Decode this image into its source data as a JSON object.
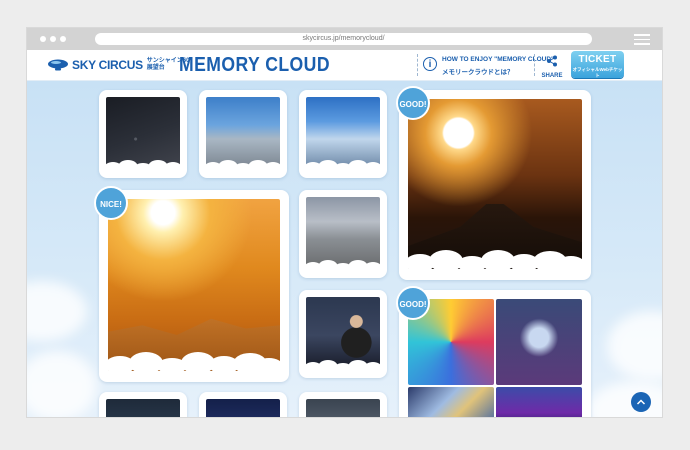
{
  "browser": {
    "url": "skycircus.jp/memorycloud/"
  },
  "header": {
    "logo_text": "SKY CIRCUS",
    "logo_sub_line1": "サンシャイン60",
    "logo_sub_line2": "展望台",
    "logo_sub_num": "60",
    "site_title": "MEMORY CLOUD",
    "how_line1": "HOW TO ENJOY \"MEMORY CLOUD\"",
    "how_line2": "メモリークラウドとは？",
    "share_label": "SHARE",
    "ticket_main": "TICKET",
    "ticket_sub": "オフィシャルWebチケット"
  },
  "badges": {
    "good_1": "GOOD!",
    "nice": "NICE!",
    "good_2": "GOOD!"
  },
  "colors": {
    "brand_blue": "#1b5fae",
    "badge_blue": "#4fa3d9",
    "sky_bg": "#c8e1f5",
    "ticket_blue": "#3aa3dc"
  },
  "icons": {
    "info": "info-icon",
    "share": "share-icon",
    "blimp": "blimp-logo-icon",
    "scroll_top": "chevron-up-icon",
    "menu": "hamburger-menu-icon"
  }
}
